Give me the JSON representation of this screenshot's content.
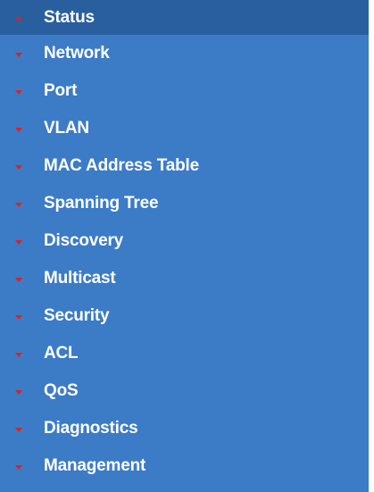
{
  "sidebar": {
    "items": [
      {
        "label": "Status",
        "icon": "chevron-down-icon",
        "active": true
      },
      {
        "label": "Network",
        "icon": "chevron-down-icon"
      },
      {
        "label": "Port",
        "icon": "chevron-down-icon"
      },
      {
        "label": "VLAN",
        "icon": "chevron-down-icon"
      },
      {
        "label": "MAC Address Table",
        "icon": "chevron-down-icon"
      },
      {
        "label": "Spanning Tree",
        "icon": "chevron-down-icon"
      },
      {
        "label": "Discovery",
        "icon": "chevron-down-icon"
      },
      {
        "label": "Multicast",
        "icon": "chevron-down-icon"
      },
      {
        "label": "Security",
        "icon": "chevron-down-icon"
      },
      {
        "label": "ACL",
        "icon": "chevron-down-icon"
      },
      {
        "label": "QoS",
        "icon": "chevron-down-icon"
      },
      {
        "label": "Diagnostics",
        "icon": "chevron-down-icon"
      },
      {
        "label": "Management",
        "icon": "chevron-down-icon"
      }
    ]
  },
  "colors": {
    "background": "#3c7bc6",
    "active_background": "#2a5f9f",
    "text": "#ffffff",
    "arrow": "#e02020"
  }
}
